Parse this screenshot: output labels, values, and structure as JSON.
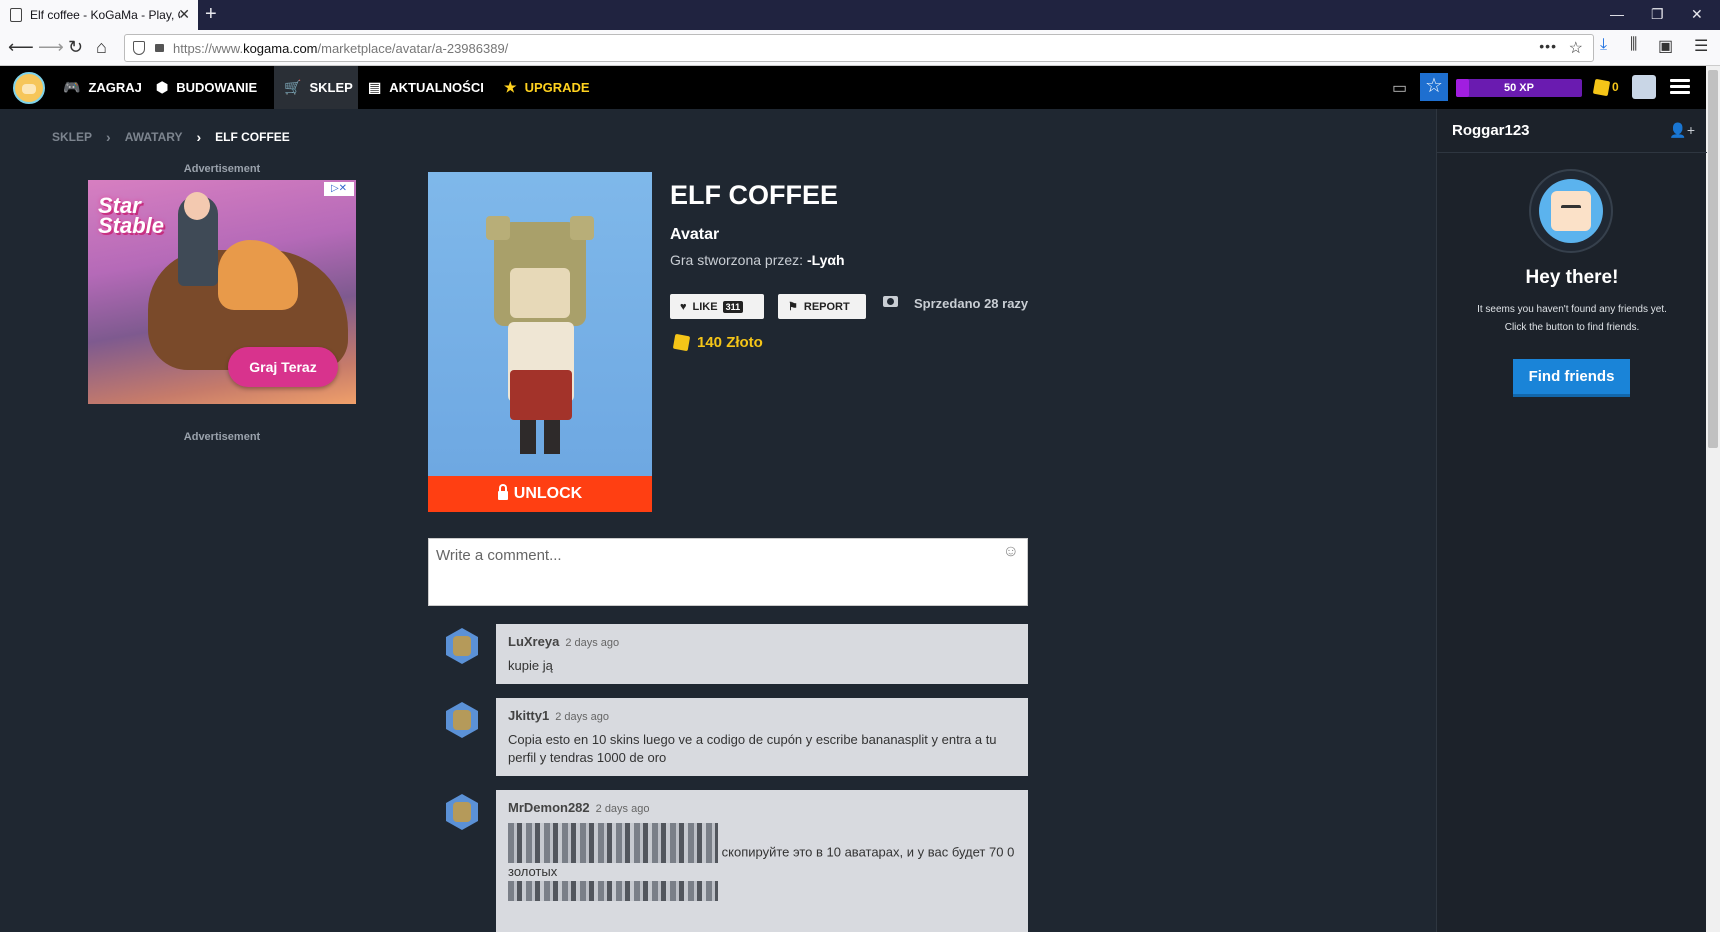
{
  "browser": {
    "tab_title": "Elf coffee - KoGaMa - Play, Create And Share Multiplayer Games",
    "url_prefix": "https://www.",
    "url_domain": "kogama.com",
    "url_path": "/marketplace/avatar/a-23986389/"
  },
  "header": {
    "nav": [
      {
        "label": "ZAGRAJ",
        "icon": "gamepad-icon"
      },
      {
        "label": "BUDOWANIE",
        "icon": "cubes-icon"
      },
      {
        "label": "SKLEP",
        "icon": "cart-icon"
      },
      {
        "label": "AKTUALNOŚCI",
        "icon": "newspaper-icon"
      },
      {
        "label": "UPGRADE",
        "icon": "star-icon"
      }
    ],
    "xp_label": "50 XP",
    "xp_progress": 0.1,
    "gold": "0"
  },
  "breadcrumb": [
    "SKLEP",
    "AWATARY",
    "ELF COFFEE"
  ],
  "ad": {
    "label": "Advertisement",
    "brand_line1": "Star",
    "brand_line2": "Stable",
    "cta": "Graj Teraz"
  },
  "product": {
    "title": "ELF COFFEE",
    "type": "Avatar",
    "creator_prefix": "Gra stworzona przez:",
    "creator": "-Lyαh",
    "like_label": "LIKE",
    "like_count": "311",
    "report_label": "REPORT",
    "sold": "Sprzedano 28 razy",
    "price": "140 Złoto",
    "unlock_label": "UNLOCK"
  },
  "comment_input": {
    "placeholder": "Write a comment..."
  },
  "comments": [
    {
      "user": "LuXreya",
      "time": "2 days ago",
      "text": "kupie ją"
    },
    {
      "user": "Jkitty1",
      "time": "2 days ago",
      "text": "Copia esto en 10 skins luego ve a codigo de cupón y escribe bananasplit y entra a tu perfil y tendras 1000 de oro"
    },
    {
      "user": "MrDemon282",
      "time": "2 days ago",
      "text": "скопируйте это в 10 аватарах, и у вас будет 70 0 золотых"
    }
  ],
  "sidebar": {
    "username": "Roggar123",
    "title": "Hey there!",
    "line1": "It seems you haven't found any friends yet.",
    "line2": "Click the button to find friends.",
    "button": "Find friends"
  }
}
